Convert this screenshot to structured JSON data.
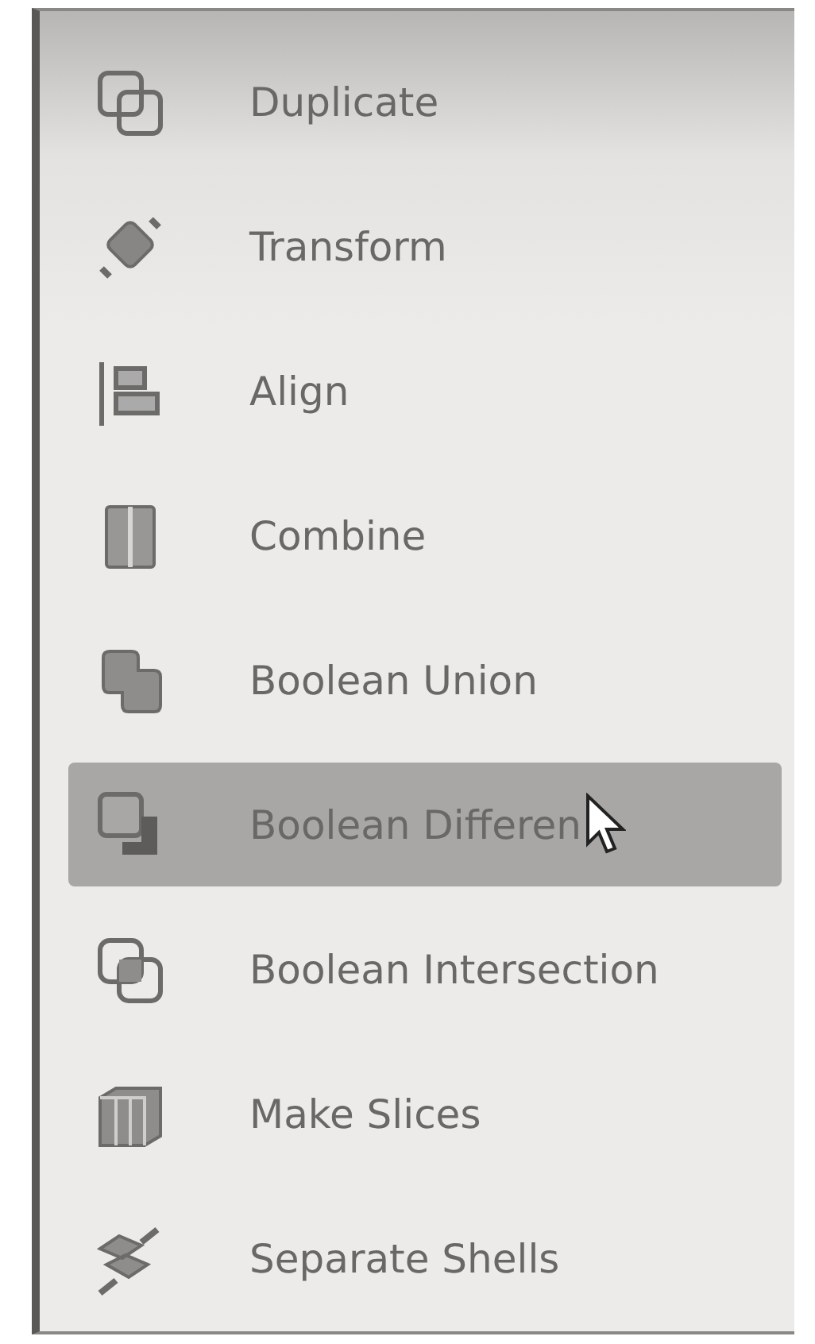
{
  "menu": {
    "items": [
      {
        "kind": "duplicate",
        "label": "Duplicate",
        "selected": false
      },
      {
        "kind": "transform",
        "label": "Transform",
        "selected": false
      },
      {
        "kind": "align",
        "label": "Align",
        "selected": false
      },
      {
        "kind": "combine",
        "label": "Combine",
        "selected": false
      },
      {
        "kind": "union",
        "label": "Boolean Union",
        "selected": false
      },
      {
        "kind": "difference",
        "label": "Boolean Differen",
        "selected": true
      },
      {
        "kind": "intersection",
        "label": "Boolean Intersection",
        "selected": false
      },
      {
        "kind": "slices",
        "label": "Make Slices",
        "selected": false
      },
      {
        "kind": "shells",
        "label": "Separate Shells",
        "selected": false
      }
    ]
  }
}
